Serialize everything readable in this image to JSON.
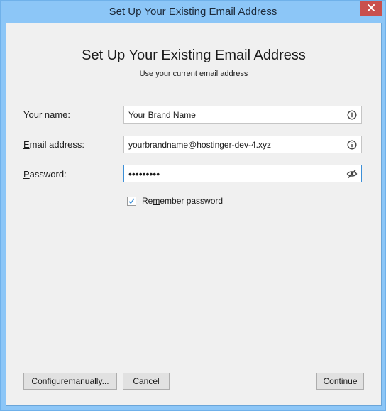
{
  "window": {
    "title": "Set Up Your Existing Email Address",
    "close_icon": "close-icon",
    "colors": {
      "frame": "#8cc6f7",
      "close_button": "#c9504d",
      "client_bg": "#f0f0f0",
      "focus_border": "#3c8fd7",
      "checkmark": "#3c8fd7"
    }
  },
  "header": {
    "title": "Set Up Your Existing Email Address",
    "subtitle": "Use your current email address"
  },
  "form": {
    "name": {
      "label_pre": "Your ",
      "label_accel": "n",
      "label_post": "ame:",
      "value": "Your Brand Name",
      "icon": "info-icon"
    },
    "email": {
      "label_pre": "",
      "label_accel": "E",
      "label_post": "mail address:",
      "value": "yourbrandname@hostinger-dev-4.xyz",
      "icon": "info-icon"
    },
    "password": {
      "label_pre": "",
      "label_accel": "P",
      "label_post": "assword:",
      "value": "•••••••••",
      "icon": "eye-slash-icon",
      "focused": true
    },
    "remember": {
      "label_pre": "Re",
      "label_accel": "m",
      "label_post": "ember password",
      "checked": true
    }
  },
  "buttons": {
    "configure": {
      "pre": "Configure ",
      "accel": "m",
      "post": "anually..."
    },
    "cancel": {
      "pre": "C",
      "accel": "a",
      "post": "ncel"
    },
    "continue": {
      "pre": "",
      "accel": "C",
      "post": "ontinue"
    }
  }
}
